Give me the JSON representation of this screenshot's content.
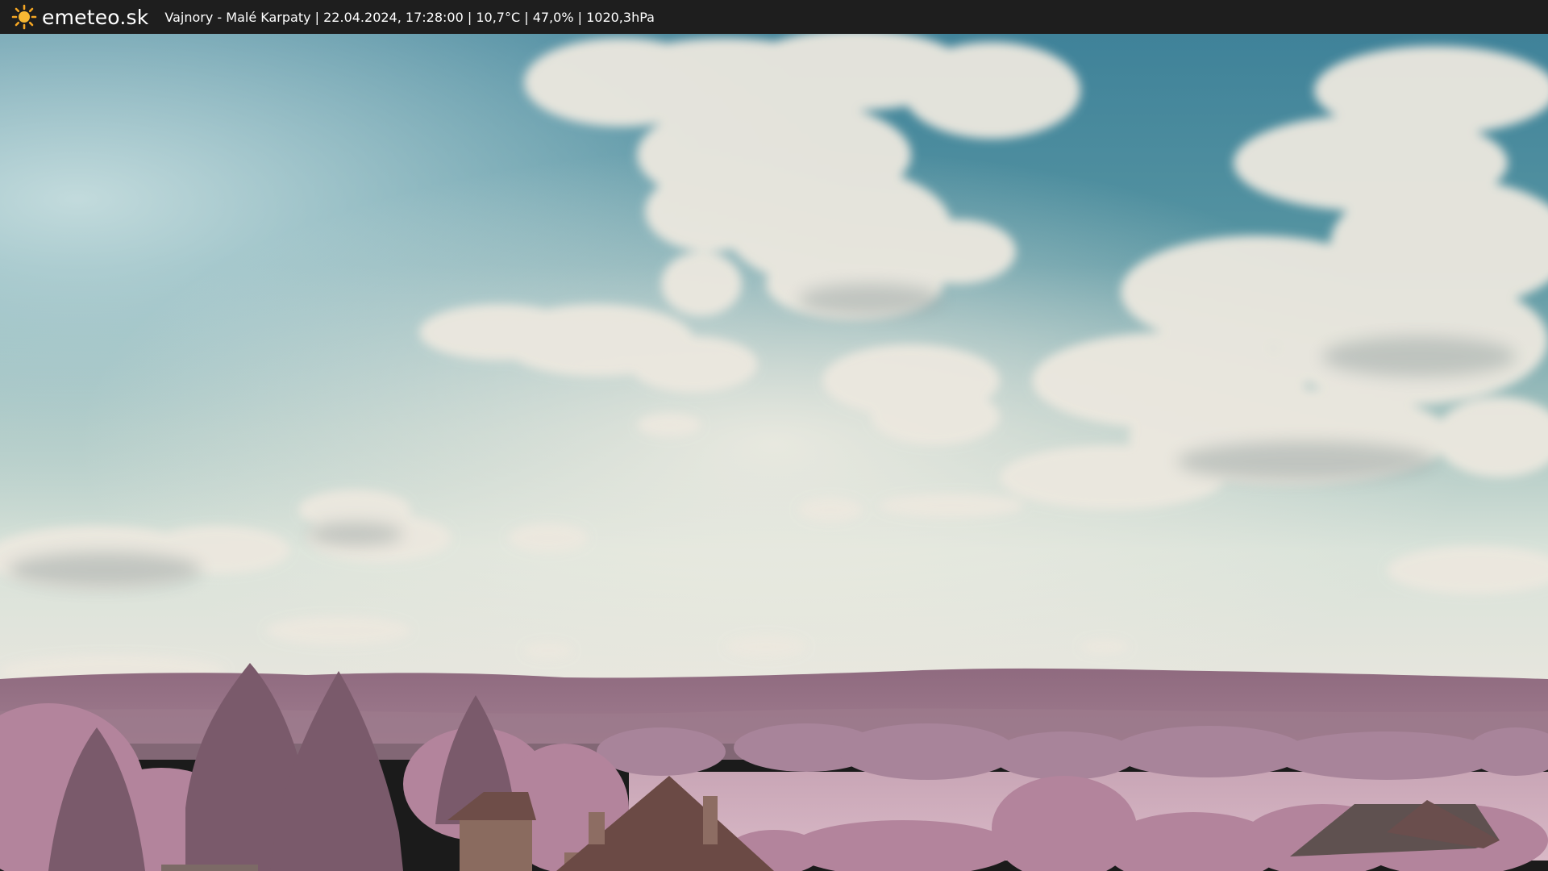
{
  "header": {
    "brand": "emeteo.sk",
    "info": "Vajnory - Malé Karpaty | 22.04.2024, 17:28:00 | 10,7°C | 47,0% | 1020,3hPa",
    "logo_icon": "sun-icon"
  },
  "colors": {
    "bar_background": "#1e1e1e",
    "sun": "#f5a623",
    "sky_top": "#3f8299",
    "sky_horizon": "#d8e2d9",
    "foliage": "#b3849c"
  }
}
